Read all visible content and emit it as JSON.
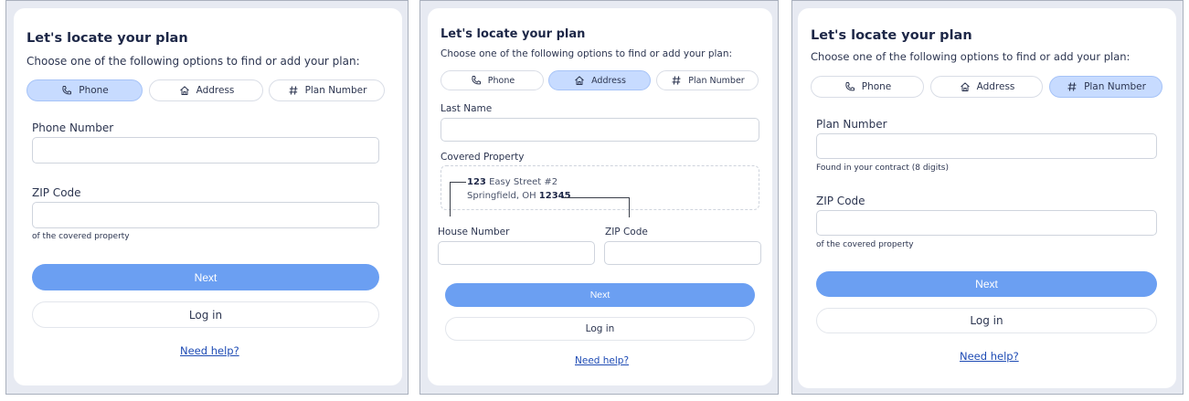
{
  "panels": [
    {
      "variant": "phone",
      "title": "Let's locate your plan",
      "subtitle": "Choose one of the following options to find or add your plan:",
      "tabs": [
        {
          "label": "Phone",
          "icon": "phone-icon",
          "active": true
        },
        {
          "label": "Address",
          "icon": "home-icon",
          "active": false
        },
        {
          "label": "Plan Number",
          "icon": "hash-icon",
          "active": false
        }
      ],
      "fields": {
        "phone_label": "Phone Number",
        "phone_value": "",
        "zip_label": "ZIP Code",
        "zip_value": "",
        "zip_hint": "of the covered property"
      },
      "next_label": "Next",
      "login_label": "Log in",
      "help_label": "Need help?"
    },
    {
      "variant": "address",
      "title": "Let's locate your plan",
      "subtitle": "Choose one of the following options to find or add your plan:",
      "tabs": [
        {
          "label": "Phone",
          "icon": "phone-icon",
          "active": false
        },
        {
          "label": "Address",
          "icon": "home-icon",
          "active": true
        },
        {
          "label": "Plan Number",
          "icon": "hash-icon",
          "active": false
        }
      ],
      "fields": {
        "last_name_label": "Last Name",
        "last_name_value": "",
        "covered_property_label": "Covered Property",
        "address_number": "123",
        "address_line1_rest": "Easy Street #2",
        "address_line2_prefix": "Springfield, OH",
        "address_zip": "12345",
        "house_number_label": "House Number",
        "house_number_value": "",
        "zip_label": "ZIP Code",
        "zip_value": ""
      },
      "next_label": "Next",
      "login_label": "Log in",
      "help_label": "Need help?"
    },
    {
      "variant": "plan_number",
      "title": "Let's locate your plan",
      "subtitle": "Choose one of the following options to find or add your plan:",
      "tabs": [
        {
          "label": "Phone",
          "icon": "phone-icon",
          "active": false
        },
        {
          "label": "Address",
          "icon": "home-icon",
          "active": false
        },
        {
          "label": "Plan Number",
          "icon": "hash-icon",
          "active": true
        }
      ],
      "fields": {
        "plan_label": "Plan Number",
        "plan_value": "",
        "plan_hint": "Found in your contract (8 digits)",
        "zip_label": "ZIP Code",
        "zip_value": "",
        "zip_hint": "of the covered property"
      },
      "next_label": "Next",
      "login_label": "Log in",
      "help_label": "Need help?"
    }
  ],
  "colors": {
    "primary": "#6b9ff2",
    "tab_active": "#c7dbff",
    "link": "#1e4bb4",
    "frame_bg": "#e7eaf2"
  }
}
